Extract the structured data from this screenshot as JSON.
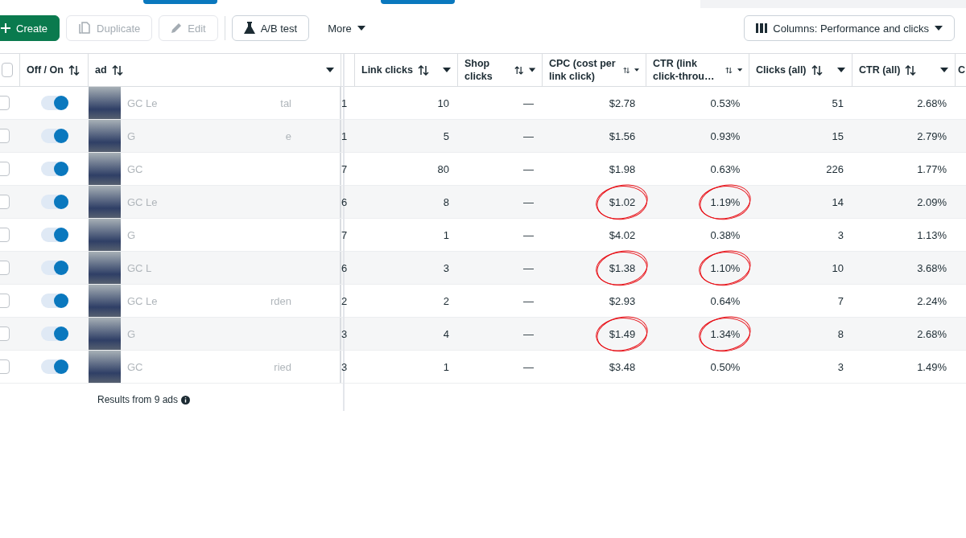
{
  "toolbar": {
    "buttons": [
      {
        "label": "Create",
        "kind": "primary"
      },
      {
        "label": "Duplicate",
        "kind": "disabled"
      },
      {
        "label": "Edit",
        "kind": "disabled"
      },
      {
        "label": "A/B test",
        "kind": "outline"
      },
      {
        "label": "More",
        "kind": "menu"
      }
    ],
    "columns_button": {
      "label": "Columns: Performance and clicks"
    }
  },
  "table": {
    "columns": [
      {
        "label": "Off / On",
        "kind": "sort"
      },
      {
        "label": "ad",
        "kind": "sort_menu"
      },
      {
        "kind": "menu"
      },
      {
        "label": "Link clicks",
        "kind": "sort_menu"
      },
      {
        "label": "Shop clicks",
        "kind": "sort_menu"
      },
      {
        "label": "CPC (cost per link click)",
        "kind": "sort_menu"
      },
      {
        "label": "CTR (link click-throu…",
        "kind": "sort_menu"
      },
      {
        "label": "Clicks (all)",
        "kind": "sort_menu"
      },
      {
        "label": "CTR (all)",
        "kind": "sort_menu"
      },
      {
        "label": "C",
        "kind": "plain"
      }
    ],
    "select_all_checked": false,
    "rows": [
      {
        "checked": false,
        "on": true,
        "ad_name_start": "GC Le",
        "ad_name_end": "tal",
        "column_3": "1",
        "link_clicks": "10",
        "shop_clicks": "—",
        "cpc": {
          "value": "$2.78",
          "circled": false
        },
        "ctr_link": {
          "value": "0.53%",
          "circled": false
        },
        "clicks_all": "51",
        "ctr_all": "2.68%"
      },
      {
        "checked": false,
        "on": true,
        "ad_name_start": "G",
        "ad_name_end": "e",
        "column_3": "1",
        "link_clicks": "5",
        "shop_clicks": "—",
        "cpc": {
          "value": "$1.56",
          "circled": false
        },
        "ctr_link": {
          "value": "0.93%",
          "circled": false
        },
        "clicks_all": "15",
        "ctr_all": "2.79%"
      },
      {
        "checked": false,
        "on": true,
        "ad_name_start": "GC",
        "column_3": "7",
        "link_clicks": "80",
        "shop_clicks": "—",
        "cpc": {
          "value": "$1.98",
          "circled": false
        },
        "ctr_link": {
          "value": "0.63%",
          "circled": false
        },
        "clicks_all": "226",
        "ctr_all": "1.77%"
      },
      {
        "checked": false,
        "on": true,
        "ad_name_start": "GC Le",
        "column_3": "6",
        "link_clicks": "8",
        "shop_clicks": "—",
        "cpc": {
          "value": "$1.02",
          "circled": true
        },
        "ctr_link": {
          "value": "1.19%",
          "circled": true
        },
        "clicks_all": "14",
        "ctr_all": "2.09%"
      },
      {
        "checked": false,
        "on": true,
        "ad_name_start": "G",
        "column_3": "7",
        "link_clicks": "1",
        "shop_clicks": "—",
        "cpc": {
          "value": "$4.02",
          "circled": false
        },
        "ctr_link": {
          "value": "0.38%",
          "circled": false
        },
        "clicks_all": "3",
        "ctr_all": "1.13%"
      },
      {
        "checked": false,
        "on": true,
        "ad_name_start": "GC L",
        "column_3": "6",
        "link_clicks": "3",
        "shop_clicks": "—",
        "cpc": {
          "value": "$1.38",
          "circled": true
        },
        "ctr_link": {
          "value": "1.10%",
          "circled": true
        },
        "clicks_all": "10",
        "ctr_all": "3.68%"
      },
      {
        "checked": false,
        "on": true,
        "ad_name_start": "GC Le",
        "ad_name_end": "rden",
        "column_3": "2",
        "link_clicks": "2",
        "shop_clicks": "—",
        "cpc": {
          "value": "$2.93",
          "circled": false
        },
        "ctr_link": {
          "value": "0.64%",
          "circled": false
        },
        "clicks_all": "7",
        "ctr_all": "2.24%"
      },
      {
        "checked": false,
        "on": true,
        "ad_name_start": "G",
        "column_3": "3",
        "link_clicks": "4",
        "shop_clicks": "—",
        "cpc": {
          "value": "$1.49",
          "circled": true
        },
        "ctr_link": {
          "value": "1.34%",
          "circled": true
        },
        "clicks_all": "8",
        "ctr_all": "2.68%"
      },
      {
        "checked": false,
        "on": true,
        "ad_name_start": "GC",
        "ad_name_end": "ried",
        "column_3": "3",
        "link_clicks": "1",
        "shop_clicks": "—",
        "cpc": {
          "value": "$3.48",
          "circled": false
        },
        "ctr_link": {
          "value": "0.50%",
          "circled": false
        },
        "clicks_all": "3",
        "ctr_all": "1.49%"
      }
    ],
    "footer": "Results from 9 ads"
  }
}
